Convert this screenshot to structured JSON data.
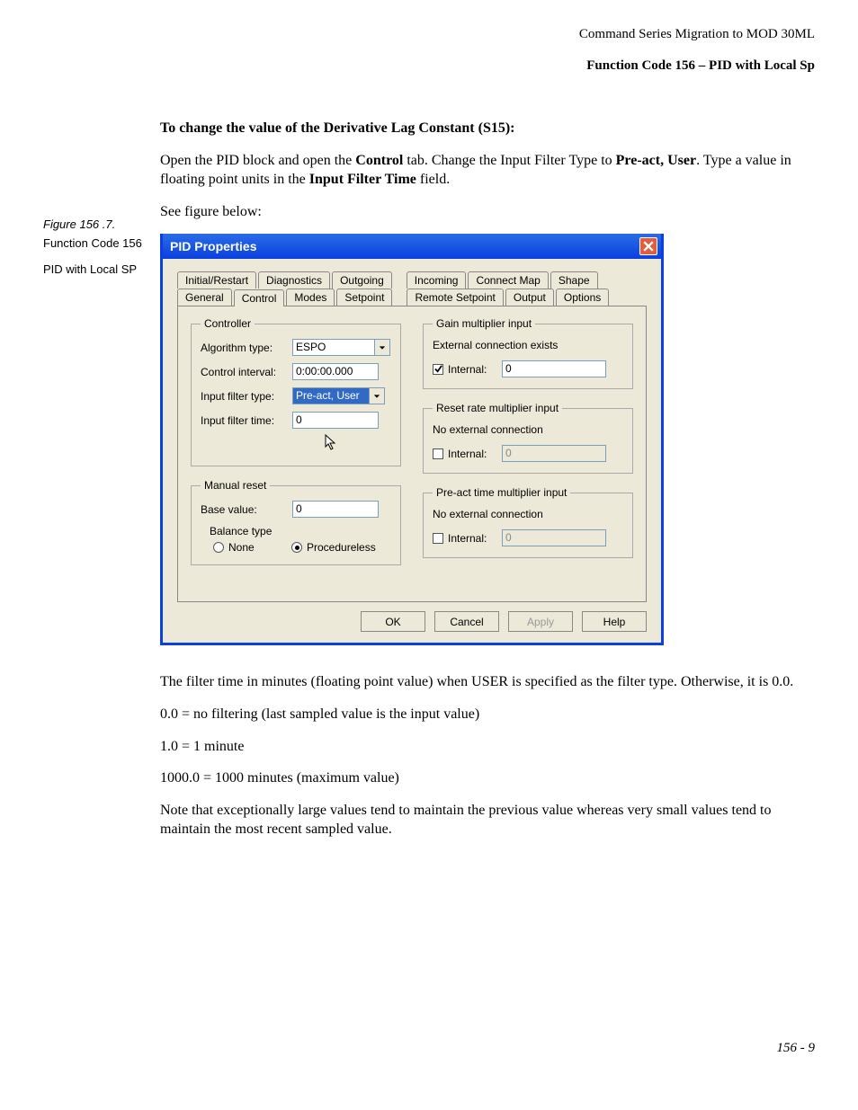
{
  "header": {
    "line1": "Command Series Migration to MOD 30ML",
    "line2": "Function Code 156 – PID with Local Sp"
  },
  "sidebar": {
    "figure": "Figure 156 .7.",
    "fc": "Function Code 156",
    "desc": "PID with Local SP"
  },
  "body": {
    "h1": "To change the value of the Derivative Lag Constant (S15):",
    "p1a": "Open the PID block and open the ",
    "p1b": "Control",
    "p1c": " tab. Change the Input Filter Type to ",
    "p1d": "Pre-act, User",
    "p1e": ". Type a value in floating point units in the ",
    "p1f": "Input Filter Time",
    "p1g": " field.",
    "p2": "See figure below:",
    "after1": "The filter time in minutes (floating point value) when USER is specified as the filter type. Otherwise, it is 0.0.",
    "after2": "0.0 = no filtering (last sampled value is the input value)",
    "after3": "1.0 = 1 minute",
    "after4": "1000.0 = 1000 minutes (maximum value)",
    "after5": "Note that exceptionally large values tend to maintain the previous value whereas very small values tend to maintain the most recent sampled value."
  },
  "dialog": {
    "title": "PID Properties",
    "tabs_row1": [
      "Initial/Restart",
      "Diagnostics",
      "Outgoing",
      "Incoming",
      "Connect Map",
      "Shape"
    ],
    "tabs_row2": [
      "General",
      "Control",
      "Modes",
      "Setpoint",
      "Remote Setpoint",
      "Output",
      "Options"
    ],
    "active_tab": "Control",
    "controller": {
      "legend": "Controller",
      "algo_label": "Algorithm type:",
      "algo_value": "ESPO",
      "interval_label": "Control interval:",
      "interval_value": "0:00:00.000",
      "filter_type_label": "Input filter type:",
      "filter_type_value": "Pre-act, User",
      "filter_time_label": "Input filter time:",
      "filter_time_value": "0"
    },
    "manual_reset": {
      "legend": "Manual reset",
      "base_label": "Base value:",
      "base_value": "0",
      "balance_label": "Balance type",
      "none": "None",
      "proc": "Procedureless",
      "selected": "Procedureless"
    },
    "gain": {
      "legend": "Gain multiplier input",
      "ext": "External connection exists",
      "internal_label": "Internal:",
      "internal_checked": true,
      "internal_value": "0"
    },
    "reset": {
      "legend": "Reset rate multiplier input",
      "ext": "No external connection",
      "internal_label": "Internal:",
      "internal_checked": false,
      "internal_value": "0"
    },
    "preact": {
      "legend": "Pre-act time multiplier input",
      "ext": "No external connection",
      "internal_label": "Internal:",
      "internal_checked": false,
      "internal_value": "0"
    },
    "buttons": {
      "ok": "OK",
      "cancel": "Cancel",
      "apply": "Apply",
      "help": "Help"
    }
  },
  "pagenum": "156 - 9"
}
